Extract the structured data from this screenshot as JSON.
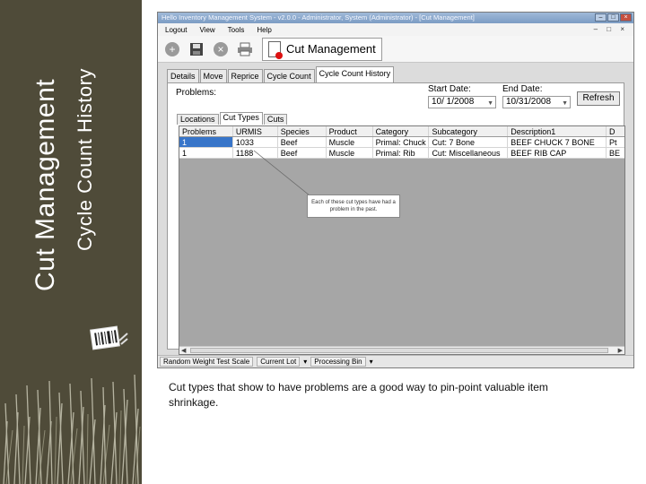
{
  "slide": {
    "title": "Cut Management",
    "subtitle": "Cycle Count History",
    "caption": "Cut types that show to have problems are a good way to pin-point valuable item shrinkage."
  },
  "window": {
    "title": "Hello Inventory Management System - v2.0.0 - Administrator, System (Administrator) - [Cut Management]",
    "menu": [
      "Logout",
      "View",
      "Tools",
      "Help"
    ],
    "app_title": "Cut Management"
  },
  "tabs": [
    "Details",
    "Move",
    "Reprice",
    "Cycle Count",
    "Cycle Count History"
  ],
  "filters": {
    "problems_label": "Problems:",
    "start_label": "Start Date:",
    "start_value": "10/ 1/2008",
    "end_label": "End Date:",
    "end_value": "10/31/2008",
    "refresh": "Refresh"
  },
  "subtabs": [
    "Locations",
    "Cut Types",
    "Cuts"
  ],
  "table": {
    "columns": [
      "Problems",
      "URMIS",
      "Species",
      "Product",
      "Category",
      "Subcategory",
      "Description1",
      "D"
    ],
    "rows": [
      [
        "1",
        "1033",
        "Beef",
        "Muscle",
        "Primal: Chuck",
        "Cut: 7 Bone",
        "BEEF CHUCK 7 BONE",
        "Pt"
      ],
      [
        "1",
        "1188",
        "Beef",
        "Muscle",
        "Primal: Rib",
        "Cut: Miscellaneous",
        "BEEF RIB CAP",
        "BE"
      ]
    ]
  },
  "callout": "Each of these cut types have had a problem in the past.",
  "status": [
    "Random Weight Test Scale",
    "Current Lot",
    "Processing Bin"
  ]
}
